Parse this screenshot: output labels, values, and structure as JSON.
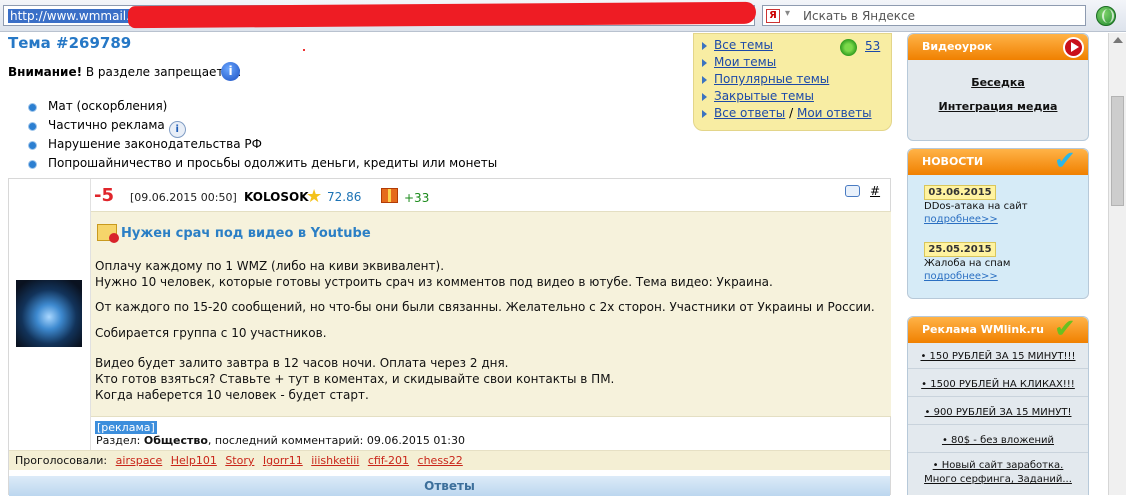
{
  "browser": {
    "url": "http://www.wmmail.ru/",
    "search_engine_badge": "Я",
    "search_placeholder": "Искать в Яндексе"
  },
  "header": {
    "topic_title": "Тема #269789",
    "warning_label": "Внимание!",
    "warning_text": " В разделе запрещается:",
    "info_icon": "i"
  },
  "rules": [
    "Мат (оскорбления)",
    "Частично реклама",
    "Нарушение законодательства РФ",
    "Попрошайничество и просьбы одолжить деньги, кредиты или монеты"
  ],
  "topics_menu": {
    "items": [
      "Все темы",
      "Мои темы",
      "Популярные темы",
      "Закрытые темы"
    ],
    "all_answers": "Все ответы",
    "separator": "/",
    "my_answers": "Мои ответы",
    "count": "53"
  },
  "post": {
    "score": "-5",
    "date": "[09.06.2015 00:50]",
    "author": "KOLOSOK",
    "reputation": "72.86",
    "bonus": "+33",
    "anchor": "#",
    "title": "Нужен срач под видео в Youtube",
    "paragraphs": [
      "Оплачу каждому по 1 WMZ (либо на киви эквивалент).\nНужно 10 человек, которые готовы устроить срач из комментов под видео в ютубе. Тема видео: Украина.",
      "От каждого по 15-20 сообщений, но что-бы они были связанны. Желательно с 2х сторон. Участники от Украины и России.",
      "Собирается группа с 10 участников.",
      "Видео будет залито завтра в 12 часов ночи. Оплата через 2 дня.\nКто готов взяться? Ставьте + тут в коментах, и скидывайте свои контакты в ПМ.\nКогда наберется 10 человек - будет старт."
    ],
    "ad_tag": "[реклама]",
    "section_label": "Раздел: ",
    "section_name": "Общество",
    "last_comment": ", последний комментарий: 09.06.2015 01:30",
    "voted_label": "Проголосовали:",
    "voters": [
      "airspace",
      "Help101",
      "Story",
      "Igorr11",
      "iiishketiii",
      "cfif-201",
      "chess22"
    ],
    "answers_label": "Ответы"
  },
  "sidebar": {
    "video": {
      "header": "Видеоурок",
      "links": [
        "Беседка",
        "Интеграция медиа"
      ]
    },
    "news": {
      "header": "НОВОСТИ",
      "items": [
        {
          "date": "03.06.2015",
          "text": "DDos-атака на сайт",
          "more": "подробнее>>"
        },
        {
          "date": "25.05.2015",
          "text": "Жалоба на спам",
          "more": "подробнее>>"
        }
      ]
    },
    "ads": {
      "header": "Реклама WMlink.ru",
      "links": [
        "• 150 РУБЛЕЙ ЗА 15 МИНУТ!!!",
        "• 1500 РУБЛЕЙ НА КЛИКАХ!!!",
        "• 900 РУБЛЕЙ ЗА 15 МИНУТ!",
        "• 80$ - без вложений",
        "• Новый сайт заработка.",
        "Много серфинга, Заданий..."
      ]
    }
  },
  "colors": {
    "accent_blue": "#2678c6",
    "score_red": "#e0252b",
    "sidebar_orange": "#f08000",
    "topics_yellow": "#f8eda3"
  }
}
